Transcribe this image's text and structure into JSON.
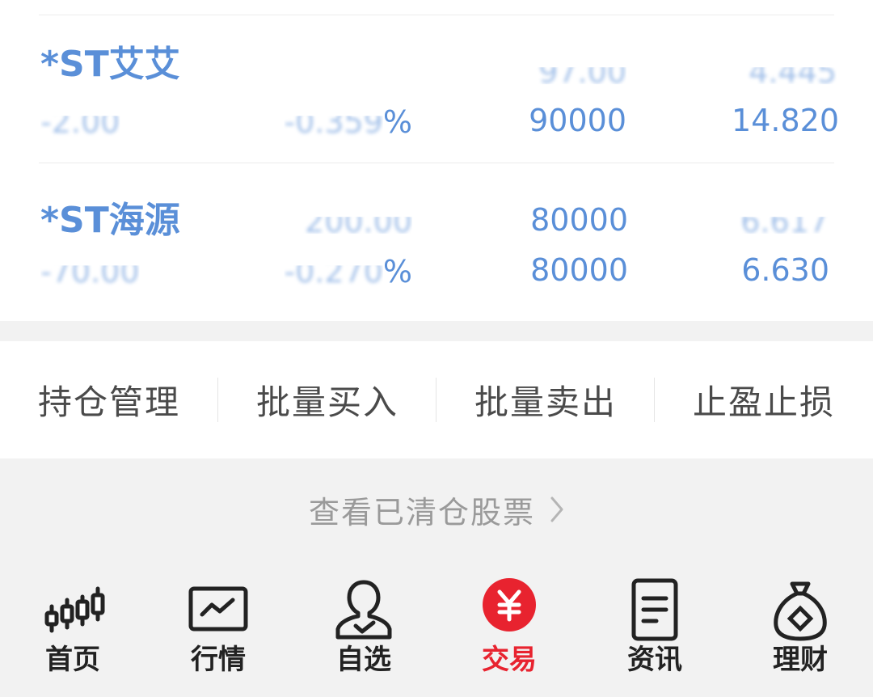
{
  "holdings": [
    {
      "name": "*ST艾艾",
      "row1": {
        "col2": "",
        "col3": "",
        "col4": ""
      },
      "row2": {
        "col1": "",
        "col2": "%",
        "col3": "90000",
        "col4": "14.820"
      }
    },
    {
      "name": "*ST海源",
      "row1": {
        "col2": "",
        "col3": "80000",
        "col4": ""
      },
      "row2": {
        "col1": "",
        "col2": "%",
        "col3": "80000",
        "col4": "6.630"
      }
    }
  ],
  "actions": [
    "持仓管理",
    "批量买入",
    "批量卖出",
    "止盈止损"
  ],
  "cleared_link": {
    "label": "查看已清仓股票",
    "chevron": "›"
  },
  "tabbar": {
    "items": [
      {
        "label": "首页",
        "icon": "candlestick-icon"
      },
      {
        "label": "行情",
        "icon": "chart-line-icon"
      },
      {
        "label": "自选",
        "icon": "user-check-icon"
      },
      {
        "label": "交易",
        "icon": "yuan-icon",
        "active": true
      },
      {
        "label": "资讯",
        "icon": "document-icon"
      },
      {
        "label": "理财",
        "icon": "money-bag-icon"
      }
    ]
  },
  "colors": {
    "accent": "#e8232f",
    "value_blue": "#5a8fd8",
    "text": "#4a4a4a"
  }
}
